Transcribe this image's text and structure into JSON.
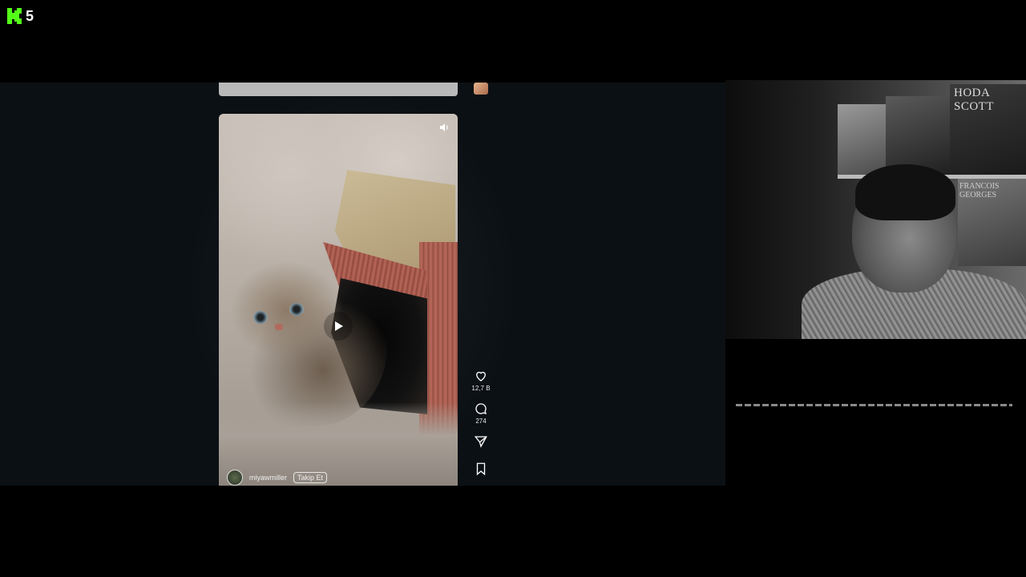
{
  "stream": {
    "logo_letter": "K",
    "logo_number": "5",
    "brand_color": "#53fc18"
  },
  "reel": {
    "author": "miyawmiller",
    "follow_label": "Takip Et",
    "icons": {
      "mute": "speaker-icon",
      "play": "play-icon"
    }
  },
  "actions": {
    "likes": "12,7 B",
    "comments": "274",
    "icons": {
      "like": "heart-icon",
      "comment": "comment-icon",
      "share": "send-icon",
      "save": "bookmark-icon"
    }
  },
  "webcam": {
    "poster_text_1": "HODA SCOTT",
    "poster_text_2": "FRANCOIS GEORGES"
  }
}
